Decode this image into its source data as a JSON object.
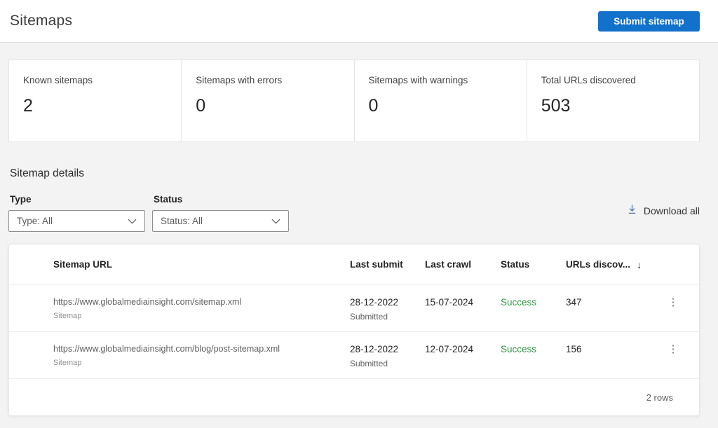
{
  "header": {
    "title": "Sitemaps",
    "submit_button": "Submit sitemap"
  },
  "stats": [
    {
      "label": "Known sitemaps",
      "value": "2"
    },
    {
      "label": "Sitemaps with errors",
      "value": "0"
    },
    {
      "label": "Sitemaps with warnings",
      "value": "0"
    },
    {
      "label": "Total URLs discovered",
      "value": "503"
    }
  ],
  "details": {
    "heading": "Sitemap details",
    "filters": [
      {
        "label": "Type",
        "value": "Type: All"
      },
      {
        "label": "Status",
        "value": "Status: All"
      }
    ],
    "download_all_label": "Download all"
  },
  "table": {
    "columns": [
      "Sitemap URL",
      "Last submit",
      "Last crawl",
      "Status",
      "URLs discov..."
    ],
    "sort": {
      "column": "URLs discov...",
      "direction": "descending",
      "icon": "down-arrow"
    },
    "rows": [
      {
        "url": "https://www.globalmediainsight.com/sitemap.xml",
        "type": "Sitemap",
        "last_submit": "28-12-2022",
        "last_submit_sub": "Submitted",
        "last_crawl": "15-07-2024",
        "status": "Success",
        "urls_discovered": "347"
      },
      {
        "url": "https://www.globalmediainsight.com/blog/post-sitemap.xml",
        "type": "Sitemap",
        "last_submit": "28-12-2022",
        "last_submit_sub": "Submitted",
        "last_crawl": "12-07-2024",
        "status": "Success",
        "urls_discovered": "156"
      }
    ],
    "footer": "2 rows"
  },
  "icons": {
    "download": "download-icon",
    "chevron": "chevron-down-icon",
    "sort": "sort-descending-icon",
    "kebab": "more-options-icon"
  },
  "colors": {
    "accent_blue": "#1171cb",
    "success_green": "#2e9443",
    "download_icon_blue": "#4a72aa",
    "page_background": "#f3f3f3"
  }
}
